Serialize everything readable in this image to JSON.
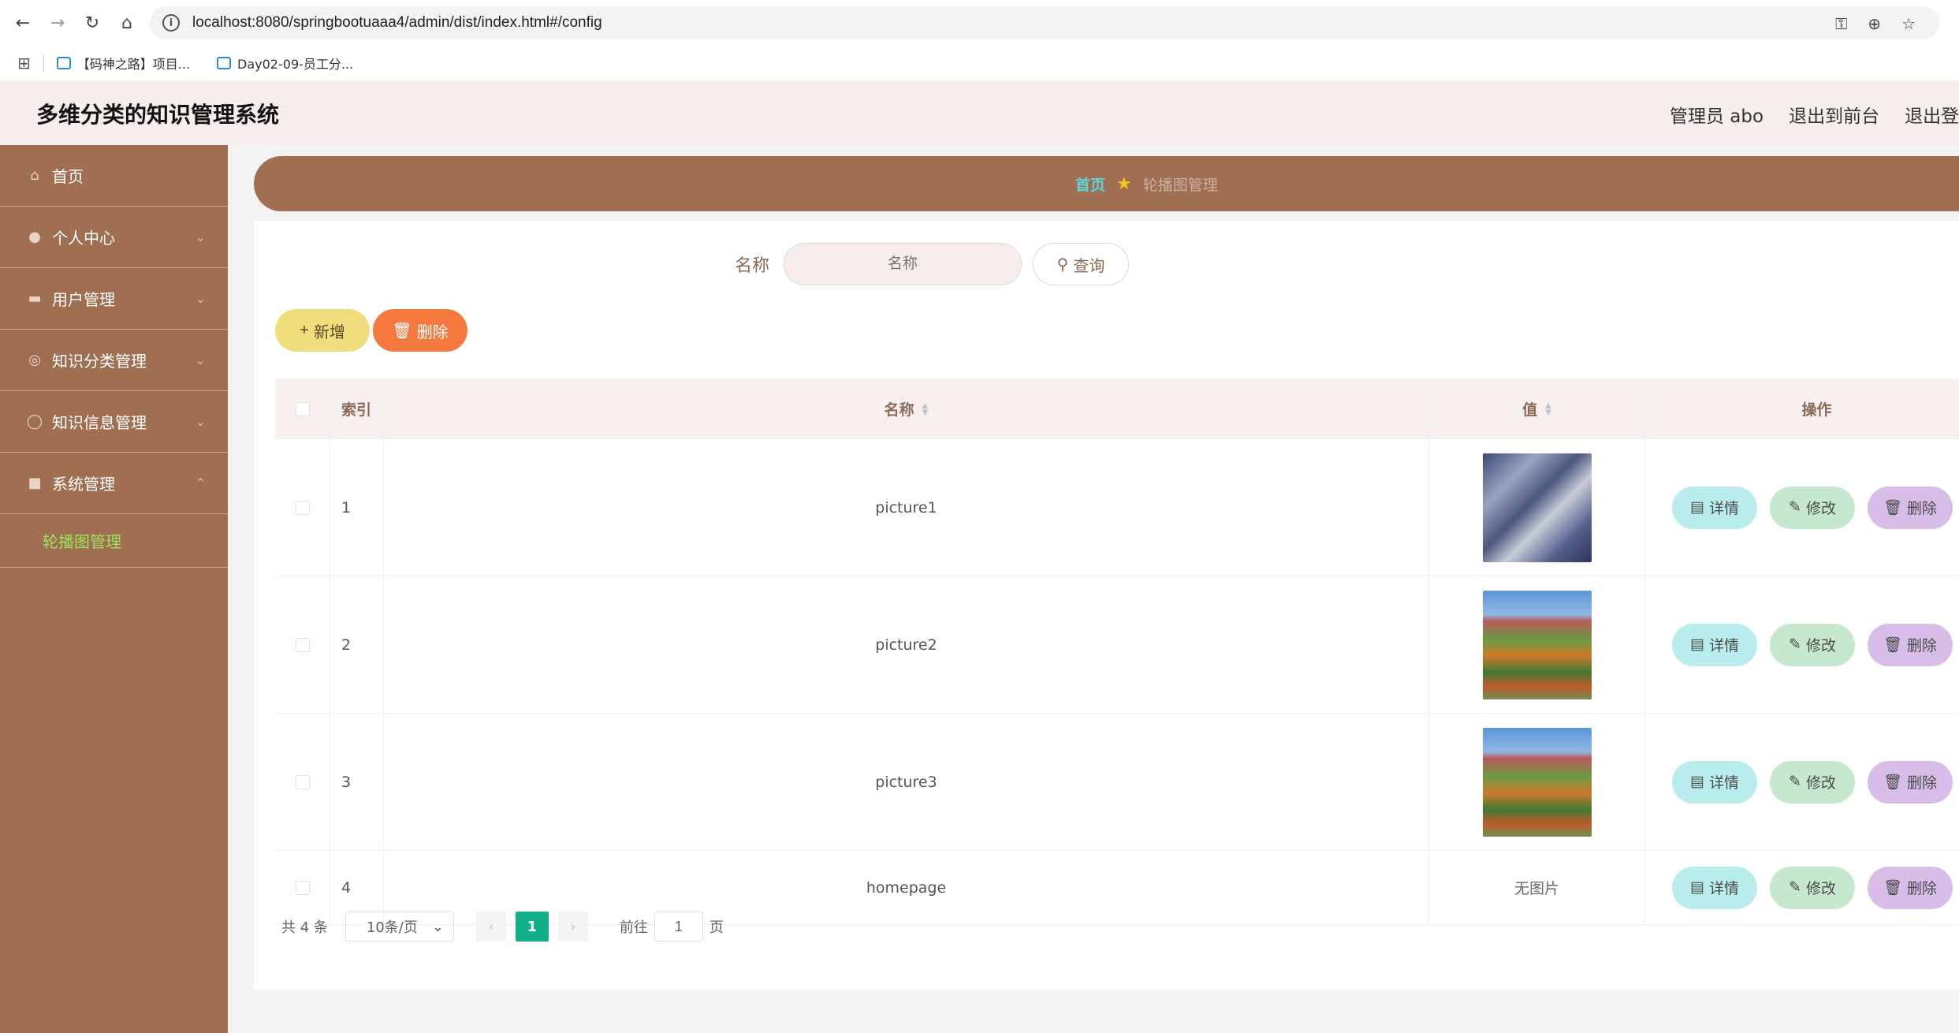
{
  "browser": {
    "url": "localhost:8080/springbootuaaa4/admin/dist/index.html#/config",
    "bookmarks": [
      "【码神之路】项目...",
      "Day02-09-员工分..."
    ]
  },
  "header": {
    "title": "多维分类的知识管理系统",
    "admin_label": "管理员 abo",
    "to_front": "退出到前台",
    "logout": "退出登录"
  },
  "sidebar": {
    "items": [
      {
        "label": "首页",
        "icon": "home-icon"
      },
      {
        "label": "个人中心",
        "icon": "user-icon"
      },
      {
        "label": "用户管理",
        "icon": "users-icon"
      },
      {
        "label": "知识分类管理",
        "icon": "compass-icon"
      },
      {
        "label": "知识信息管理",
        "icon": "circle-icon"
      },
      {
        "label": "系统管理",
        "icon": "briefcase-icon"
      }
    ],
    "active_sub": "轮播图管理"
  },
  "breadcrumb": {
    "home": "首页",
    "current": "轮播图管理"
  },
  "search": {
    "label": "名称",
    "placeholder": "名称",
    "button": "查询"
  },
  "actions": {
    "add": "新增",
    "delete": "删除"
  },
  "table": {
    "headers": {
      "index": "索引",
      "name": "名称",
      "value": "值",
      "ops": "操作"
    },
    "rows": [
      {
        "index": "1",
        "name": "picture1",
        "value": "image"
      },
      {
        "index": "2",
        "name": "picture2",
        "value": "image"
      },
      {
        "index": "3",
        "name": "picture3",
        "value": "image"
      },
      {
        "index": "4",
        "name": "homepage",
        "value": "无图片"
      }
    ],
    "op_labels": {
      "detail": "详情",
      "edit": "修改",
      "delete": "删除"
    }
  },
  "pagination": {
    "total": "共 4 条",
    "page_size": "10条/页",
    "current_page": "1",
    "goto_label": "前往",
    "goto_value": "1",
    "page_suffix": "页"
  },
  "colors": {
    "sidebar": "#a06e51",
    "active_sub": "#9be35c",
    "pager_active": "#12b08a"
  }
}
